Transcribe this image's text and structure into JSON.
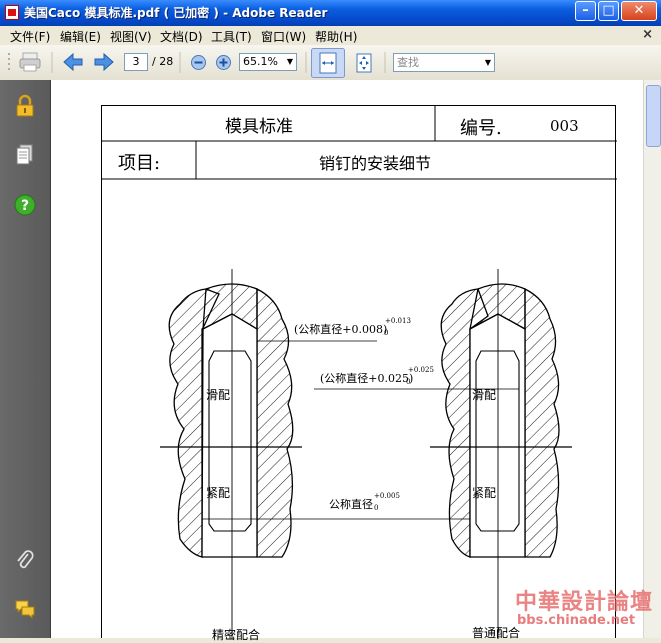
{
  "window": {
    "title": "美国Caco 模具标准.pdf ( 已加密 ) - Adobe Reader",
    "minimize": "–",
    "maximize": "□",
    "close": "✕"
  },
  "menu": {
    "items": [
      "文件(F)",
      "编辑(E)",
      "视图(V)",
      "文档(D)",
      "工具(T)",
      "窗口(W)",
      "帮助(H)"
    ],
    "doc_close": "×"
  },
  "toolbar": {
    "page_current": "3",
    "page_total": "/ 28",
    "zoom": "65.1%",
    "search_placeholder": "查找"
  },
  "document": {
    "header_title": "模具标准",
    "number_label": "编号.",
    "number_value": "003",
    "project_label": "项目:",
    "project_value": "销钉的安装细节",
    "annotations": {
      "slide_fit_left": "滑配",
      "tight_fit_left": "紧配",
      "slide_fit_right": "滑配",
      "tight_fit_right": "紧配",
      "dim1": "(公称直径+0.008)",
      "dim1_sup": "+0.013",
      "dim1_sub": "0",
      "dim2": "(公称直径+0.025)",
      "dim2_sup": "+0.025",
      "dim2_sub": "0",
      "dim3": "公称直径",
      "dim3_sup": "+0.005",
      "dim3_sub": "0",
      "bottom_left": "精密配合",
      "bottom_right": "普通配合"
    }
  },
  "watermark": {
    "chinese": "中華設計論壇",
    "url": "bbs.chinade.net"
  },
  "icons": [
    "lock-icon",
    "pages-icon",
    "help-icon",
    "attachment-icon",
    "comments-icon"
  ]
}
